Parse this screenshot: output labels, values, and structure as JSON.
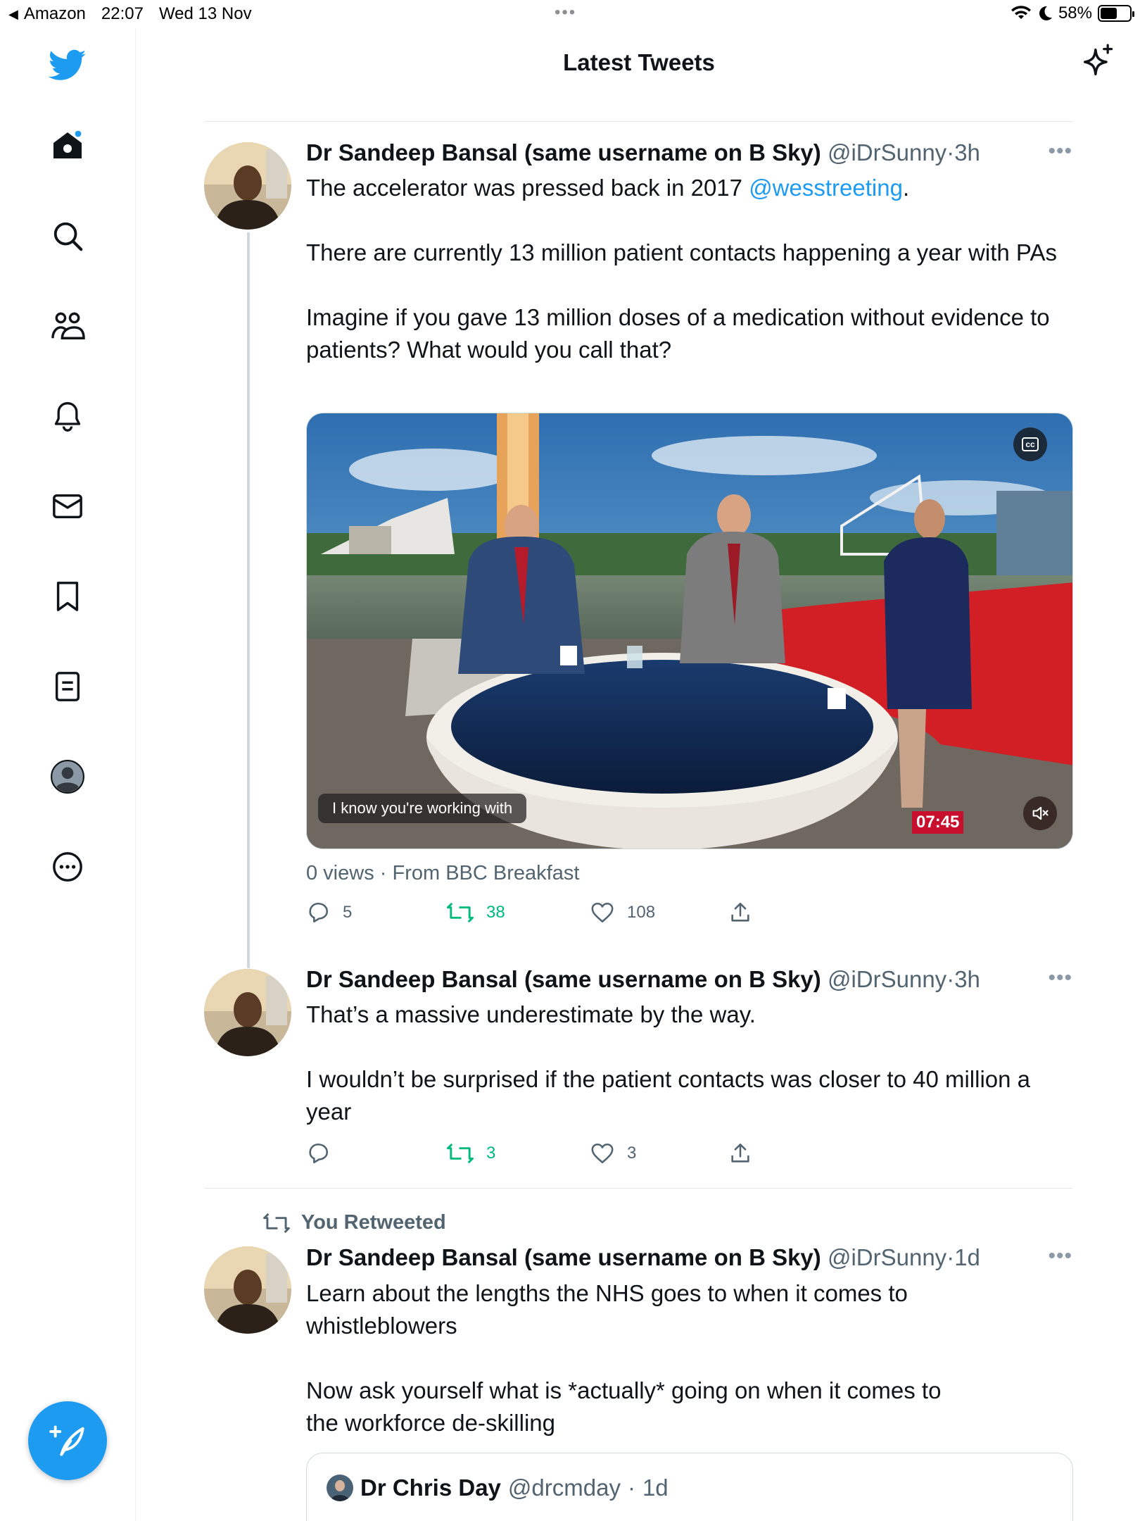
{
  "status_bar": {
    "back_app": "Amazon",
    "time": "22:07",
    "date": "Wed 13 Nov",
    "battery": "58%",
    "battery_level": 0.58
  },
  "header": {
    "title": "Latest Tweets"
  },
  "sidebar": {
    "items": [
      {
        "icon": "twitter-bird-icon"
      },
      {
        "icon": "home-icon"
      },
      {
        "icon": "search-icon"
      },
      {
        "icon": "communities-icon"
      },
      {
        "icon": "notifications-bell-icon"
      },
      {
        "icon": "messages-envelope-icon"
      },
      {
        "icon": "bookmark-icon"
      },
      {
        "icon": "lists-icon"
      },
      {
        "icon": "profile-icon"
      },
      {
        "icon": "more-circle-icon"
      }
    ],
    "compose_icon": "compose-feather-icon"
  },
  "colors": {
    "accent": "#1d9bf0",
    "retweet": "#00ba7c",
    "muted": "#536471"
  },
  "tweets": [
    {
      "name": "Dr Sandeep Bansal (same username on B Sky)",
      "handle": "@iDrSunny",
      "dot": "·",
      "time": "3h",
      "text_1_pre": "The accelerator was pressed back in 2017 ",
      "mention": "@wesstreeting",
      "text_1_post": ".",
      "text_2": "There are currently 13 million patient contacts happening a year with PAs",
      "text_3": "Imagine if you gave 13 million doses of a medication without evidence to patients? What would you call that?",
      "video": {
        "cc": "cc",
        "caption": "I know you're working with",
        "timestamp": "07:45"
      },
      "views": "0 views",
      "source": "From BBC Breakfast",
      "replies": "5",
      "retweets": "38",
      "likes": "108"
    },
    {
      "name": "Dr Sandeep Bansal (same username on B Sky)",
      "handle": "@iDrSunny",
      "dot": "·",
      "time": "3h",
      "text_1": "That’s a massive underestimate by the way.",
      "text_2": "I wouldn’t be surprised if the patient contacts was closer to 40 million a year",
      "replies": "",
      "retweets": "3",
      "likes": "3"
    },
    {
      "retweeted_label": "You Retweeted",
      "name": "Dr Sandeep Bansal (same username on B Sky)",
      "handle": "@iDrSunny",
      "dot": "·",
      "time": "1d",
      "text_1": "Learn about the lengths the NHS goes to when it comes to whistleblowers",
      "text_2": "Now ask yourself what is *actually* going on when it comes to the workforce de-skilling",
      "quote": {
        "name": "Dr Chris Day",
        "handle": "@drcmday",
        "dot": "·",
        "time": "1d"
      }
    }
  ]
}
